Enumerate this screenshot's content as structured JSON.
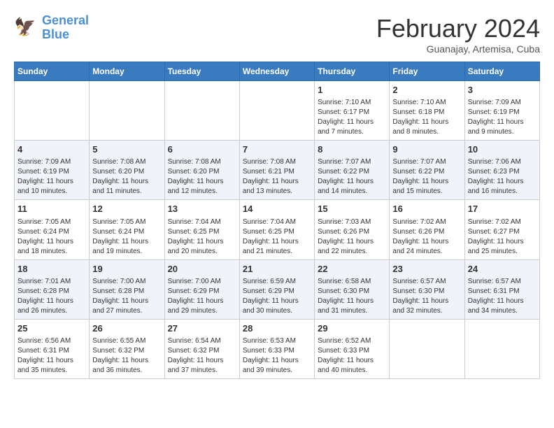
{
  "header": {
    "logo_line1": "General",
    "logo_line2": "Blue",
    "title": "February 2024",
    "subtitle": "Guanajay, Artemisa, Cuba"
  },
  "days_of_week": [
    "Sunday",
    "Monday",
    "Tuesday",
    "Wednesday",
    "Thursday",
    "Friday",
    "Saturday"
  ],
  "weeks": [
    [
      {
        "day": "",
        "info": ""
      },
      {
        "day": "",
        "info": ""
      },
      {
        "day": "",
        "info": ""
      },
      {
        "day": "",
        "info": ""
      },
      {
        "day": "1",
        "info": "Sunrise: 7:10 AM\nSunset: 6:17 PM\nDaylight: 11 hours and 7 minutes."
      },
      {
        "day": "2",
        "info": "Sunrise: 7:10 AM\nSunset: 6:18 PM\nDaylight: 11 hours and 8 minutes."
      },
      {
        "day": "3",
        "info": "Sunrise: 7:09 AM\nSunset: 6:19 PM\nDaylight: 11 hours and 9 minutes."
      }
    ],
    [
      {
        "day": "4",
        "info": "Sunrise: 7:09 AM\nSunset: 6:19 PM\nDaylight: 11 hours and 10 minutes."
      },
      {
        "day": "5",
        "info": "Sunrise: 7:08 AM\nSunset: 6:20 PM\nDaylight: 11 hours and 11 minutes."
      },
      {
        "day": "6",
        "info": "Sunrise: 7:08 AM\nSunset: 6:20 PM\nDaylight: 11 hours and 12 minutes."
      },
      {
        "day": "7",
        "info": "Sunrise: 7:08 AM\nSunset: 6:21 PM\nDaylight: 11 hours and 13 minutes."
      },
      {
        "day": "8",
        "info": "Sunrise: 7:07 AM\nSunset: 6:22 PM\nDaylight: 11 hours and 14 minutes."
      },
      {
        "day": "9",
        "info": "Sunrise: 7:07 AM\nSunset: 6:22 PM\nDaylight: 11 hours and 15 minutes."
      },
      {
        "day": "10",
        "info": "Sunrise: 7:06 AM\nSunset: 6:23 PM\nDaylight: 11 hours and 16 minutes."
      }
    ],
    [
      {
        "day": "11",
        "info": "Sunrise: 7:05 AM\nSunset: 6:24 PM\nDaylight: 11 hours and 18 minutes."
      },
      {
        "day": "12",
        "info": "Sunrise: 7:05 AM\nSunset: 6:24 PM\nDaylight: 11 hours and 19 minutes."
      },
      {
        "day": "13",
        "info": "Sunrise: 7:04 AM\nSunset: 6:25 PM\nDaylight: 11 hours and 20 minutes."
      },
      {
        "day": "14",
        "info": "Sunrise: 7:04 AM\nSunset: 6:25 PM\nDaylight: 11 hours and 21 minutes."
      },
      {
        "day": "15",
        "info": "Sunrise: 7:03 AM\nSunset: 6:26 PM\nDaylight: 11 hours and 22 minutes."
      },
      {
        "day": "16",
        "info": "Sunrise: 7:02 AM\nSunset: 6:26 PM\nDaylight: 11 hours and 24 minutes."
      },
      {
        "day": "17",
        "info": "Sunrise: 7:02 AM\nSunset: 6:27 PM\nDaylight: 11 hours and 25 minutes."
      }
    ],
    [
      {
        "day": "18",
        "info": "Sunrise: 7:01 AM\nSunset: 6:28 PM\nDaylight: 11 hours and 26 minutes."
      },
      {
        "day": "19",
        "info": "Sunrise: 7:00 AM\nSunset: 6:28 PM\nDaylight: 11 hours and 27 minutes."
      },
      {
        "day": "20",
        "info": "Sunrise: 7:00 AM\nSunset: 6:29 PM\nDaylight: 11 hours and 29 minutes."
      },
      {
        "day": "21",
        "info": "Sunrise: 6:59 AM\nSunset: 6:29 PM\nDaylight: 11 hours and 30 minutes."
      },
      {
        "day": "22",
        "info": "Sunrise: 6:58 AM\nSunset: 6:30 PM\nDaylight: 11 hours and 31 minutes."
      },
      {
        "day": "23",
        "info": "Sunrise: 6:57 AM\nSunset: 6:30 PM\nDaylight: 11 hours and 32 minutes."
      },
      {
        "day": "24",
        "info": "Sunrise: 6:57 AM\nSunset: 6:31 PM\nDaylight: 11 hours and 34 minutes."
      }
    ],
    [
      {
        "day": "25",
        "info": "Sunrise: 6:56 AM\nSunset: 6:31 PM\nDaylight: 11 hours and 35 minutes."
      },
      {
        "day": "26",
        "info": "Sunrise: 6:55 AM\nSunset: 6:32 PM\nDaylight: 11 hours and 36 minutes."
      },
      {
        "day": "27",
        "info": "Sunrise: 6:54 AM\nSunset: 6:32 PM\nDaylight: 11 hours and 37 minutes."
      },
      {
        "day": "28",
        "info": "Sunrise: 6:53 AM\nSunset: 6:33 PM\nDaylight: 11 hours and 39 minutes."
      },
      {
        "day": "29",
        "info": "Sunrise: 6:52 AM\nSunset: 6:33 PM\nDaylight: 11 hours and 40 minutes."
      },
      {
        "day": "",
        "info": ""
      },
      {
        "day": "",
        "info": ""
      }
    ]
  ]
}
